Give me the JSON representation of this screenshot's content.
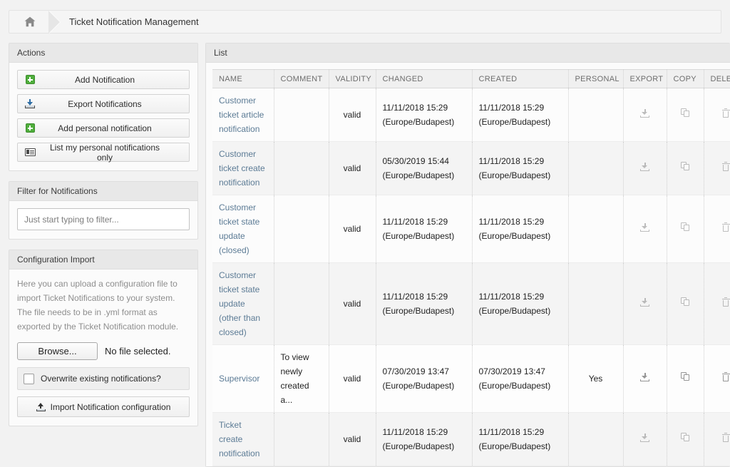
{
  "breadcrumb": {
    "home_icon": "home-icon",
    "title": "Ticket Notification Management"
  },
  "sidebar": {
    "actions": {
      "title": "Actions",
      "buttons": [
        {
          "label": "Add Notification",
          "icon": "plus-square-icon"
        },
        {
          "label": "Export Notifications",
          "icon": "download-icon"
        },
        {
          "label": "Add personal notification",
          "icon": "plus-square-icon"
        },
        {
          "label": "List my personal notifications only",
          "icon": "list-icon"
        }
      ]
    },
    "filter": {
      "title": "Filter for Notifications",
      "placeholder": "Just start typing to filter...",
      "value": ""
    },
    "import": {
      "title": "Configuration Import",
      "help": "Here you can upload a configuration file to import Ticket Notifications to your system. The file needs to be in .yml format as exported by the Ticket Notification module.",
      "browse_label": "Browse...",
      "file_status": "No file selected.",
      "overwrite_label": "Overwrite existing notifications?",
      "overwrite_checked": false,
      "submit_label": "Import Notification configuration",
      "submit_icon": "upload-icon"
    }
  },
  "main": {
    "title": "List",
    "columns": [
      "NAME",
      "COMMENT",
      "VALIDITY",
      "CHANGED",
      "CREATED",
      "PERSONAL",
      "EXPORT",
      "COPY",
      "DELETE"
    ],
    "highlight_color": "#f79361",
    "link_color": "#5c7b95",
    "rows": [
      {
        "name": "Customer ticket article notification",
        "comment": "",
        "validity": "valid",
        "changed": "11/11/2018 15:29 (Europe/Budapest)",
        "created": "11/11/2018 15:29 (Europe/Budapest)",
        "personal": "",
        "export_icon": "download-icon",
        "copy_icon": "copy-icon",
        "delete_icon": "trash-icon",
        "highlighted": false
      },
      {
        "name": "Customer ticket create notification",
        "comment": "",
        "validity": "valid",
        "changed": "05/30/2019 15:44 (Europe/Budapest)",
        "created": "11/11/2018 15:29 (Europe/Budapest)",
        "personal": "",
        "export_icon": "download-icon",
        "copy_icon": "copy-icon",
        "delete_icon": "trash-icon",
        "highlighted": false
      },
      {
        "name": "Customer ticket state update (closed)",
        "comment": "",
        "validity": "valid",
        "changed": "11/11/2018 15:29 (Europe/Budapest)",
        "created": "11/11/2018 15:29 (Europe/Budapest)",
        "personal": "",
        "export_icon": "download-icon",
        "copy_icon": "copy-icon",
        "delete_icon": "trash-icon",
        "highlighted": false
      },
      {
        "name": "Customer ticket state update (other than closed)",
        "comment": "",
        "validity": "valid",
        "changed": "11/11/2018 15:29 (Europe/Budapest)",
        "created": "11/11/2018 15:29 (Europe/Budapest)",
        "personal": "",
        "export_icon": "download-icon",
        "copy_icon": "copy-icon",
        "delete_icon": "trash-icon",
        "highlighted": false
      },
      {
        "name": "Supervisor",
        "comment": "To view newly created a...",
        "validity": "valid",
        "changed": "07/30/2019 13:47 (Europe/Budapest)",
        "created": "07/30/2019 13:47 (Europe/Budapest)",
        "personal": "Yes",
        "export_icon": "download-icon",
        "copy_icon": "copy-icon",
        "delete_icon": "trash-icon",
        "highlighted": true
      },
      {
        "name": "Ticket create notification",
        "comment": "",
        "validity": "valid",
        "changed": "11/11/2018 15:29 (Europe/Budapest)",
        "created": "11/11/2018 15:29 (Europe/Budapest)",
        "personal": "",
        "export_icon": "download-icon",
        "copy_icon": "copy-icon",
        "delete_icon": "trash-icon",
        "highlighted": false
      }
    ]
  }
}
